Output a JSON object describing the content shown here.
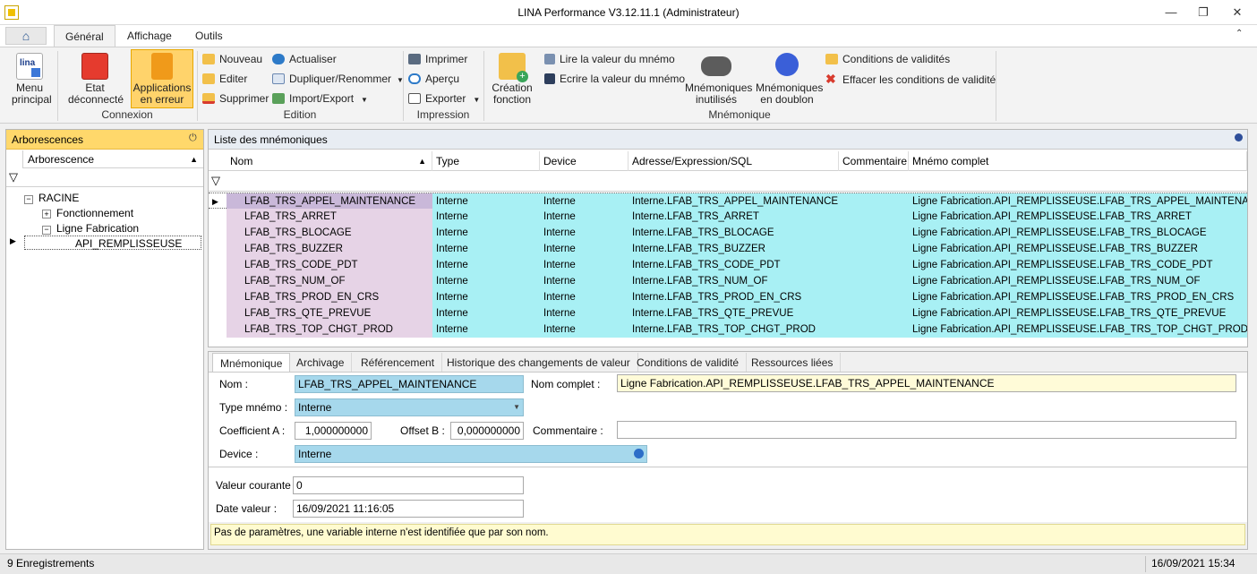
{
  "window": {
    "title": "LINA Performance  V3.12.11.1  (Administrateur)"
  },
  "ribbon_tabs": [
    "Général",
    "Affichage",
    "Outils"
  ],
  "ribbon": {
    "menu_principal": "Menu principal",
    "etat": "Etat déconnecté",
    "applications": "Applications en erreur",
    "connexion_label": "Connexion",
    "nouveau": "Nouveau",
    "editer": "Editer",
    "supprimer": "Supprimer",
    "actualiser": "Actualiser",
    "dupliquer": "Dupliquer/Renommer",
    "import_export": "Import/Export",
    "edition_label": "Edition",
    "imprimer": "Imprimer",
    "apercu": "Aperçu",
    "exporter": "Exporter",
    "impression_label": "Impression",
    "creation": "Création fonction",
    "lire": "Lire la valeur du mnémo",
    "ecrire": "Ecrire la valeur du mnémo",
    "inutilises": "Mnémoniques inutilisés",
    "doublon": "Mnémoniques en doublon",
    "mnemonique_label": "Mnémonique",
    "conditions": "Conditions de validités",
    "effacer": "Effacer les conditions de validité"
  },
  "tree": {
    "panel_title": "Arborescences",
    "column_header": "Arborescence",
    "nodes": [
      "RACINE",
      "Fonctionnement",
      "Ligne Fabrication",
      "API_REMPLISSEUSE"
    ]
  },
  "list": {
    "panel_title": "Liste des mnémoniques",
    "columns": [
      "Nom",
      "Type",
      "Device",
      "Adresse/Expression/SQL",
      "Commentaire",
      "Mnémo complet"
    ],
    "rows": [
      {
        "nom": "LFAB_TRS_APPEL_MAINTENANCE",
        "type": "Interne",
        "device": "Interne",
        "adresse": "Interne.LFAB_TRS_APPEL_MAINTENANCE",
        "commentaire": "",
        "complet": "Ligne Fabrication.API_REMPLISSEUSE.LFAB_TRS_APPEL_MAINTENANCE"
      },
      {
        "nom": "LFAB_TRS_ARRET",
        "type": "Interne",
        "device": "Interne",
        "adresse": "Interne.LFAB_TRS_ARRET",
        "commentaire": "",
        "complet": "Ligne Fabrication.API_REMPLISSEUSE.LFAB_TRS_ARRET"
      },
      {
        "nom": "LFAB_TRS_BLOCAGE",
        "type": "Interne",
        "device": "Interne",
        "adresse": "Interne.LFAB_TRS_BLOCAGE",
        "commentaire": "",
        "complet": "Ligne Fabrication.API_REMPLISSEUSE.LFAB_TRS_BLOCAGE"
      },
      {
        "nom": "LFAB_TRS_BUZZER",
        "type": "Interne",
        "device": "Interne",
        "adresse": "Interne.LFAB_TRS_BUZZER",
        "commentaire": "",
        "complet": "Ligne Fabrication.API_REMPLISSEUSE.LFAB_TRS_BUZZER"
      },
      {
        "nom": "LFAB_TRS_CODE_PDT",
        "type": "Interne",
        "device": "Interne",
        "adresse": "Interne.LFAB_TRS_CODE_PDT",
        "commentaire": "",
        "complet": "Ligne Fabrication.API_REMPLISSEUSE.LFAB_TRS_CODE_PDT"
      },
      {
        "nom": "LFAB_TRS_NUM_OF",
        "type": "Interne",
        "device": "Interne",
        "adresse": "Interne.LFAB_TRS_NUM_OF",
        "commentaire": "",
        "complet": "Ligne Fabrication.API_REMPLISSEUSE.LFAB_TRS_NUM_OF"
      },
      {
        "nom": "LFAB_TRS_PROD_EN_CRS",
        "type": "Interne",
        "device": "Interne",
        "adresse": "Interne.LFAB_TRS_PROD_EN_CRS",
        "commentaire": "",
        "complet": "Ligne Fabrication.API_REMPLISSEUSE.LFAB_TRS_PROD_EN_CRS"
      },
      {
        "nom": "LFAB_TRS_QTE_PREVUE",
        "type": "Interne",
        "device": "Interne",
        "adresse": "Interne.LFAB_TRS_QTE_PREVUE",
        "commentaire": "",
        "complet": "Ligne Fabrication.API_REMPLISSEUSE.LFAB_TRS_QTE_PREVUE"
      },
      {
        "nom": "LFAB_TRS_TOP_CHGT_PROD",
        "type": "Interne",
        "device": "Interne",
        "adresse": "Interne.LFAB_TRS_TOP_CHGT_PROD",
        "commentaire": "",
        "complet": "Ligne Fabrication.API_REMPLISSEUSE.LFAB_TRS_TOP_CHGT_PROD"
      }
    ]
  },
  "detail": {
    "tabs": [
      "Mnémonique",
      "Archivage",
      "Référencement",
      "Historique des changements de valeur",
      "Conditions de validité",
      "Ressources liées"
    ],
    "nom_label": "Nom :",
    "nom_value": "LFAB_TRS_APPEL_MAINTENANCE",
    "nom_complet_label": "Nom complet :",
    "nom_complet_value": "Ligne Fabrication.API_REMPLISSEUSE.LFAB_TRS_APPEL_MAINTENANCE",
    "type_label": "Type mnémo :",
    "type_value": "Interne",
    "coef_label": "Coefficient A :",
    "coef_value": "1,000000000",
    "offset_label": "Offset B :",
    "offset_value": "0,000000000",
    "commentaire_label": "Commentaire :",
    "commentaire_value": "",
    "device_label": "Device :",
    "device_value": "Interne",
    "valeur_label": "Valeur courante :",
    "valeur_value": "0",
    "date_label": "Date valeur :",
    "date_value": "16/09/2021 11:16:05",
    "info": "Pas de paramètres, une variable interne n'est identifiée que par son nom."
  },
  "status": {
    "records": "9 Enregistrements",
    "datetime": "16/09/2021 15:34"
  }
}
